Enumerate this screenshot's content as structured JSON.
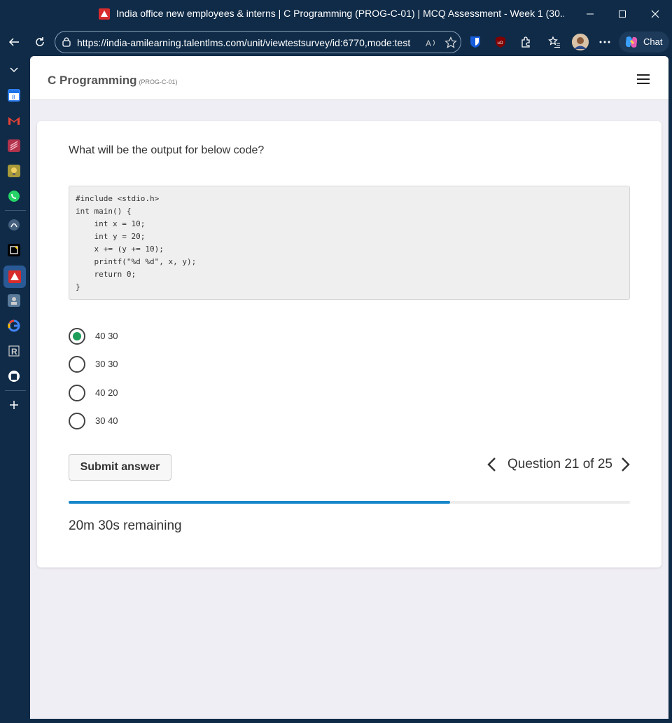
{
  "browser": {
    "window_title": "India office new employees & interns | C Programming (PROG-C-01) | MCQ Assessment - Week 1 (30...",
    "url": "https://india-amilearning.talentlms.com/unit/viewtestsurvey/id:6770,mode:test",
    "chat_label": "Chat",
    "sidebar_icons": [
      "calendar-icon",
      "gmail-icon",
      "app-icon",
      "app-icon",
      "whatsapp-icon",
      "app-icon",
      "app-icon",
      "talentlms-icon",
      "app-icon",
      "google-icon",
      "r-icon",
      "github-icon",
      "add-icon"
    ]
  },
  "header": {
    "course_title": "C Programming",
    "course_code": "(PROG-C-01)"
  },
  "question": {
    "text": "What will be the output for below code?",
    "code": [
      "#include <stdio.h>",
      "int main() {",
      "    int x = 10;",
      "    int y = 20;",
      "    x += (y += 10);",
      "    printf(\"%d %d\", x, y);",
      "    return 0;",
      "}"
    ],
    "options": [
      {
        "label": "40 30",
        "selected": true
      },
      {
        "label": "30 30",
        "selected": false
      },
      {
        "label": "40 20",
        "selected": false
      },
      {
        "label": "30 40",
        "selected": false
      }
    ]
  },
  "footer": {
    "submit_label": "Submit answer",
    "question_nav": "Question 21 of 25",
    "progress_percent": 68,
    "timer": "20m 30s remaining"
  },
  "colors": {
    "accent": "#1787c9",
    "selected_radio": "#1e9e5a",
    "browser_chrome": "#0f2b48"
  }
}
